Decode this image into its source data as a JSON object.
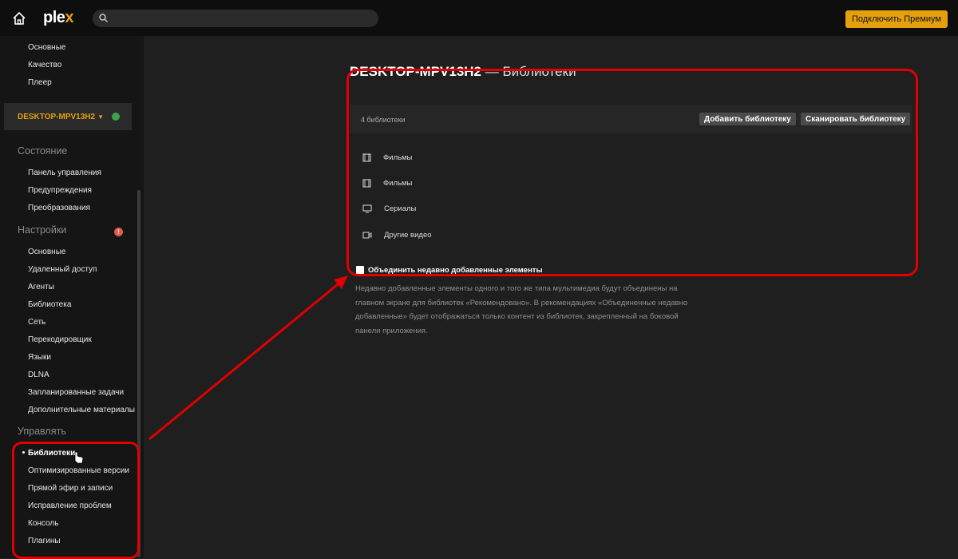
{
  "app": {
    "logo_text": "ple",
    "logo_x": "x"
  },
  "topbar": {
    "search_placeholder": "",
    "premium_label": "Подключить Премиум"
  },
  "sidebar": {
    "top_items": [
      "Основные",
      "Качество",
      "Плеер"
    ],
    "server_name": "DESKTOP-MPV13H2",
    "server_caret": "▼",
    "status_header": "Состояние",
    "status_items": [
      "Панель управления",
      "Предупреждения",
      "Преобразования"
    ],
    "settings_header": "Настройки",
    "settings_items": [
      "Основные",
      "Удаленный доступ",
      "Агенты",
      "Библиотека",
      "Сеть",
      "Перекодировщик",
      "Языки",
      "DLNA",
      "Запланированные задачи",
      "Дополнительные материалы"
    ],
    "manage_header": "Управлять",
    "manage_items": [
      "Библиотеки",
      "Оптимизированные версии",
      "Прямой эфир и записи",
      "Исправление проблем",
      "Консоль",
      "Плагины"
    ],
    "warning_mark": "!"
  },
  "main": {
    "title_server": "DESKTOP-MPV13H2",
    "title_section": " — Библиотеки",
    "library_count": "4 библиотеки",
    "add_library_label": "Добавить библиотеку",
    "scan_library_label": "Сканировать библиотеку",
    "libraries": [
      {
        "icon": "film-icon",
        "name": "Фильмы"
      },
      {
        "icon": "film-icon",
        "name": "Фильмы"
      },
      {
        "icon": "tv-icon",
        "name": "Сериалы"
      },
      {
        "icon": "video-camera-icon",
        "name": "Другие видео"
      }
    ],
    "merge_label": "Объединить недавно добавленные элементы",
    "merge_description": "Недавно добавленные элементы одного и того же типа мультимедиа будут объединены на главном экране для библиотек «Рекомендовано». В рекомендациях «Объединенные недавно добавленные» будет отображаться только контент из библиотек, закрепленный на боковой панели приложения."
  },
  "colors": {
    "accent": "#e5a00d",
    "highlight": "#e00000",
    "background": "#1f1f1f",
    "sidebar": "#151515"
  }
}
